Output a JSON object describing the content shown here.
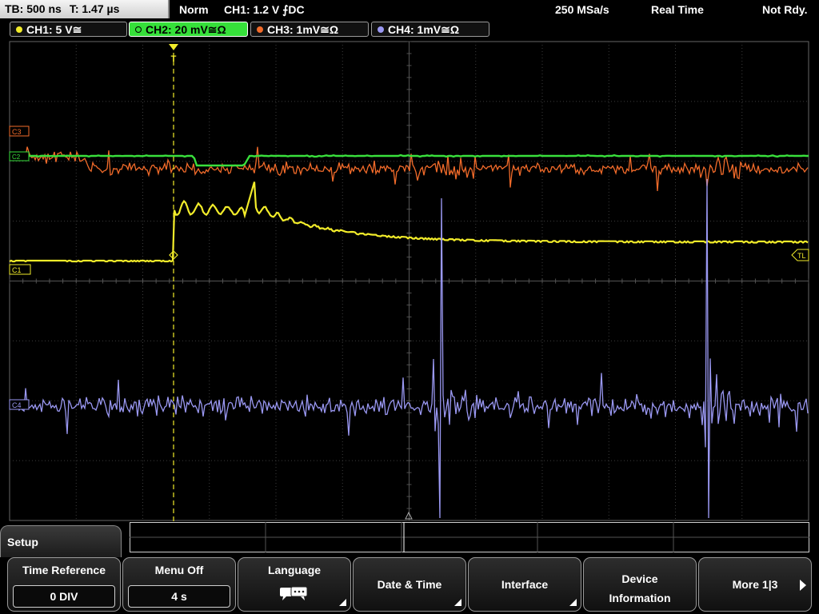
{
  "status_bar": {
    "timebase": "TB: 500 ns",
    "trigger_time": "T: 1.47 µs",
    "trigger_mode": "Norm",
    "trigger_info": "CH1: 1.2 V ⨍DC",
    "sample_rate": "250 MSa/s",
    "acq_mode": "Real Time",
    "state": "Not Rdy."
  },
  "channels": [
    {
      "label": "CH1: 5 V≅",
      "color": "#f2ec2a",
      "active": false
    },
    {
      "label": "CH2: 20 mV≅Ω",
      "color": "#39e03c",
      "active": true
    },
    {
      "label": "CH3: 1mV≅Ω",
      "color": "#f26b2a",
      "active": false
    },
    {
      "label": "CH4: 1mV≅Ω",
      "color": "#9a98f2",
      "active": false
    }
  ],
  "markers": {
    "c3": "C3",
    "c2": "C2",
    "c1": "C1",
    "c4": "C4",
    "trigger_level": "TL",
    "trigger_pos": "T"
  },
  "colors": {
    "ch1": "#f2ec2a",
    "ch2": "#39e03c",
    "ch3": "#f26b2a",
    "ch4": "#9a98f2",
    "grid": "#3c3c3c"
  },
  "menu": {
    "title": "Setup",
    "softkeys": [
      {
        "label": "Time Reference",
        "value": "0 DIV",
        "icon": null
      },
      {
        "label": "Menu Off",
        "value": "4 s",
        "icon": null
      },
      {
        "label": "Language",
        "value": null,
        "icon": "speech-bubbles-icon"
      },
      {
        "label": "Date & Time",
        "value": null,
        "icon": null
      },
      {
        "label": "Interface",
        "value": null,
        "icon": null
      },
      {
        "label": "Device Information",
        "value": null,
        "icon": null
      },
      {
        "label": "More 1|3",
        "value": null,
        "icon": "arrow-right-icon"
      }
    ]
  }
}
